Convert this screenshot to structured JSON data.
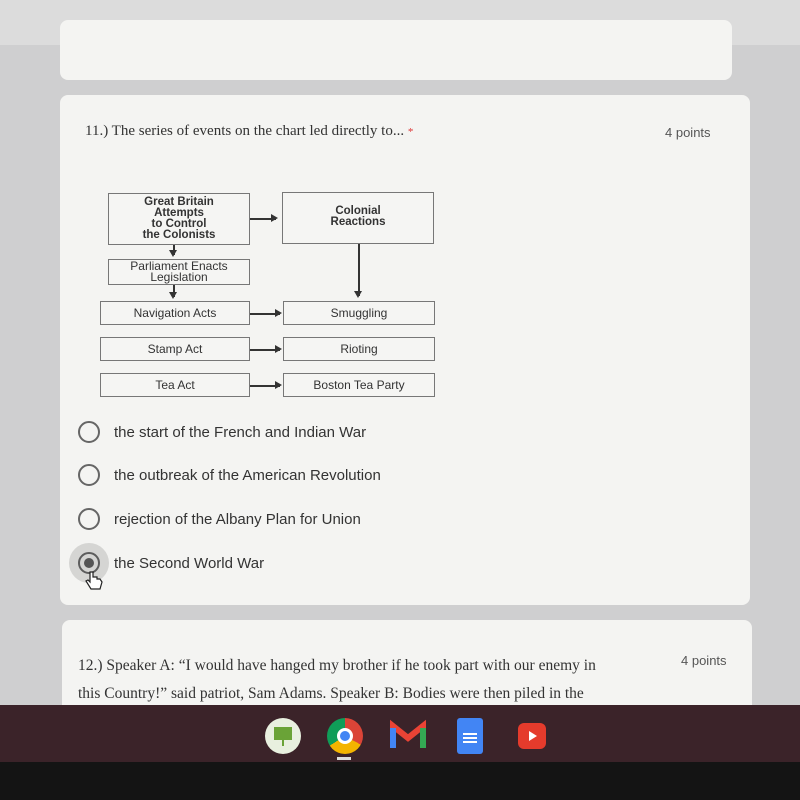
{
  "question11": {
    "title": "11.) The series of events on the chart led directly to...",
    "required_mark": "*",
    "points": "4 points",
    "diagram": {
      "great_britain": [
        "Great Britain",
        "Attempts",
        "to Control",
        "the Colonists"
      ],
      "colonial": [
        "Colonial",
        "Reactions"
      ],
      "parliament": [
        "Parliament Enacts",
        "Legislation"
      ],
      "rows": [
        {
          "cause": "Navigation Acts",
          "effect": "Smuggling"
        },
        {
          "cause": "Stamp Act",
          "effect": "Rioting"
        },
        {
          "cause": "Tea Act",
          "effect": "Boston Tea Party"
        }
      ]
    },
    "options": [
      {
        "label": "the start of the French and Indian War",
        "selected": false
      },
      {
        "label": "the outbreak of the American Revolution",
        "selected": false
      },
      {
        "label": "rejection of the Albany Plan for Union",
        "selected": false
      },
      {
        "label": "the Second World War",
        "selected": true
      }
    ]
  },
  "question12": {
    "line1": "12.) Speaker A: “I would have hanged my brother if he took part with our enemy in",
    "line2": "this Country!” said patriot, Sam Adams. Speaker B: Bodies were then piled in the",
    "points": "4 points"
  },
  "taskbar": {
    "apps": [
      "classroom-screen-icon",
      "chrome-icon",
      "gmail-icon",
      "docs-icon",
      "youtube-icon"
    ]
  }
}
